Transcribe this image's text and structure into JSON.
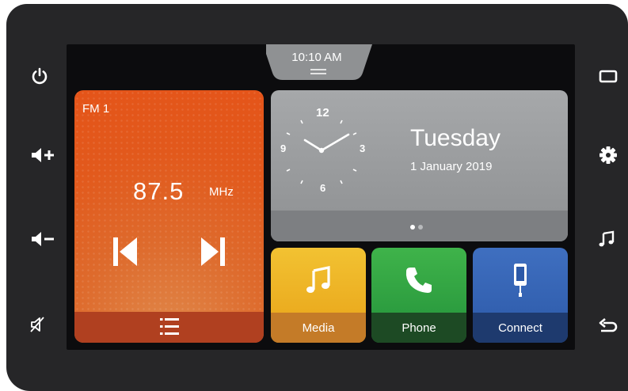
{
  "status_bar": {
    "time": "10:10 AM"
  },
  "radio": {
    "band": "FM 1",
    "frequency": "87.5",
    "unit": "MHz"
  },
  "clock_widget": {
    "day": "Tuesday",
    "date": "1 January 2019",
    "dial_numbers": [
      "12",
      "3",
      "6",
      "9"
    ],
    "analog_time": "10:10",
    "pages": 2,
    "active_page": 1
  },
  "tiles": {
    "media": "Media",
    "phone": "Phone",
    "connect": "Connect"
  },
  "colors": {
    "radio": "#e2591c",
    "media": "#f2c232",
    "phone": "#3fb34a",
    "connect": "#3f6fc0",
    "clock_card": "#9a9c9e",
    "bezel": "#262628"
  },
  "side_buttons": {
    "left": [
      "power-icon",
      "volume-up-icon",
      "volume-down-icon",
      "mute-icon"
    ],
    "right": [
      "home-icon",
      "settings-icon",
      "music-note-icon",
      "back-icon"
    ]
  }
}
